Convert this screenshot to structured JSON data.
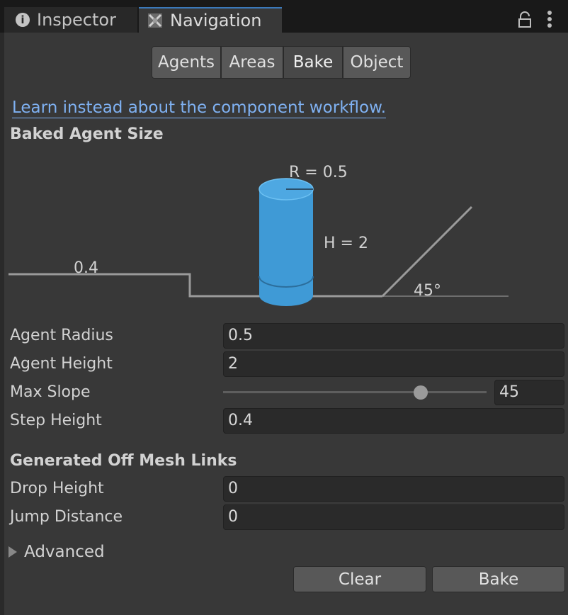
{
  "tabs": {
    "inspector": "Inspector",
    "navigation": "Navigation"
  },
  "toolbar": {
    "agents": "Agents",
    "areas": "Areas",
    "bake": "Bake",
    "object": "Object",
    "active": "Bake"
  },
  "link_text": "Learn instead about the component workflow.",
  "baked_agent_size": {
    "heading": "Baked Agent Size",
    "radius_label": "R = 0.5",
    "height_label": "H = 2",
    "step_label": "0.4",
    "slope_label": "45°"
  },
  "fields": {
    "agent_radius": {
      "label": "Agent Radius",
      "value": "0.5"
    },
    "agent_height": {
      "label": "Agent Height",
      "value": "2"
    },
    "max_slope": {
      "label": "Max Slope",
      "value": "45"
    },
    "step_height": {
      "label": "Step Height",
      "value": "0.4"
    }
  },
  "max_slope_slider": {
    "min": 0,
    "max": 60,
    "value": 45
  },
  "offmesh": {
    "heading": "Generated Off Mesh Links",
    "drop_height": {
      "label": "Drop Height",
      "value": "0"
    },
    "jump_distance": {
      "label": "Jump Distance",
      "value": "0"
    }
  },
  "advanced_label": "Advanced",
  "buttons": {
    "clear": "Clear",
    "bake": "Bake"
  },
  "colors": {
    "accent_tab": "#3a79bb",
    "link": "#7fb1f2",
    "cylinder": "#3f9ad6"
  },
  "icons": {
    "inspector": "info-icon",
    "navigation": "navmesh-icon",
    "lock": "lock-icon",
    "more": "more-vertical-icon"
  }
}
